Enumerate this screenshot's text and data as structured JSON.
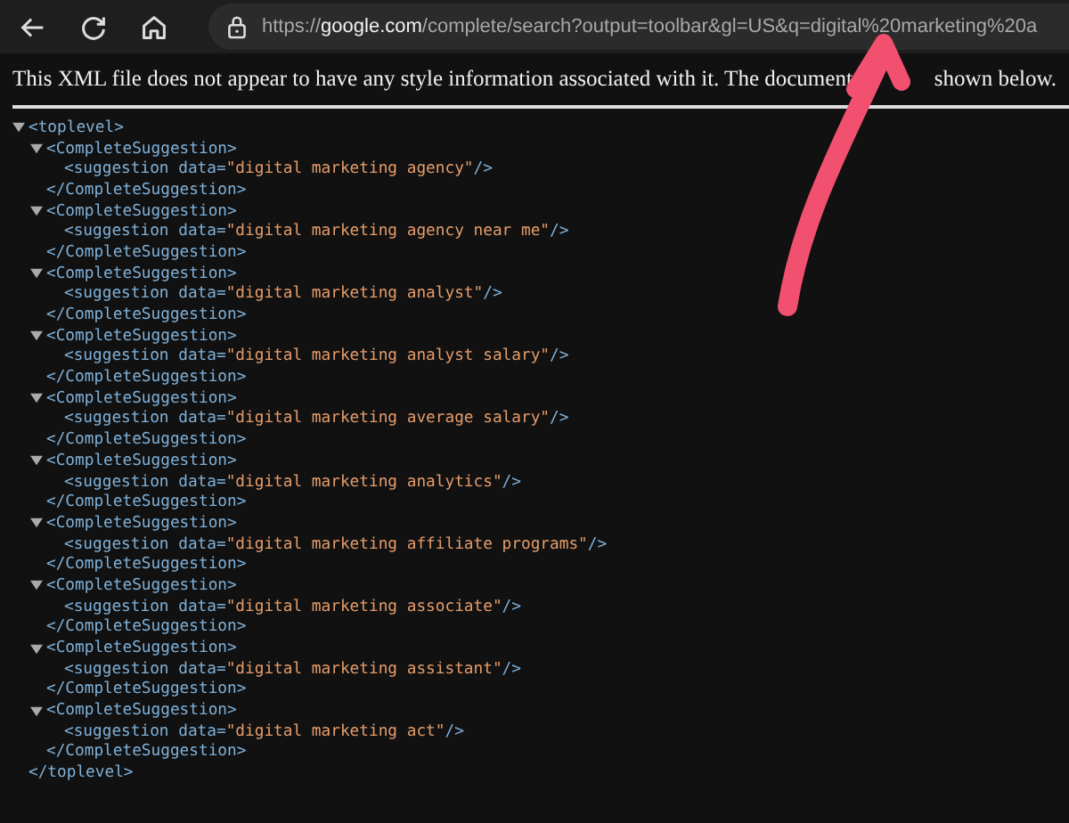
{
  "toolbar": {
    "url": {
      "scheme": "https://",
      "host": "google.com",
      "path": "/complete/search?output=toolbar&gl=US&q=digital%20marketing%20a"
    }
  },
  "notice": {
    "before_arrow": "This XML file does not appear to have any style information associated with it. The document",
    "after_arrow": "shown below."
  },
  "xml": {
    "open_tag": "<toplevel>",
    "close_tag": "</toplevel>",
    "expanded": true,
    "children": [
      {
        "open_tag": "<CompleteSuggestion>",
        "close_tag": "</CompleteSuggestion>",
        "expanded": true,
        "element": {
          "tag": "<suggestion data=",
          "value": "\"digital marketing agency\"",
          "end": "/>"
        }
      },
      {
        "open_tag": "<CompleteSuggestion>",
        "close_tag": "</CompleteSuggestion>",
        "expanded": true,
        "element": {
          "tag": "<suggestion data=",
          "value": "\"digital marketing agency near me\"",
          "end": "/>"
        }
      },
      {
        "open_tag": "<CompleteSuggestion>",
        "close_tag": "</CompleteSuggestion>",
        "expanded": true,
        "element": {
          "tag": "<suggestion data=",
          "value": "\"digital marketing analyst\"",
          "end": "/>"
        }
      },
      {
        "open_tag": "<CompleteSuggestion>",
        "close_tag": "</CompleteSuggestion>",
        "expanded": true,
        "element": {
          "tag": "<suggestion data=",
          "value": "\"digital marketing analyst salary\"",
          "end": "/>"
        }
      },
      {
        "open_tag": "<CompleteSuggestion>",
        "close_tag": "</CompleteSuggestion>",
        "expanded": true,
        "element": {
          "tag": "<suggestion data=",
          "value": "\"digital marketing average salary\"",
          "end": "/>"
        }
      },
      {
        "open_tag": "<CompleteSuggestion>",
        "close_tag": "</CompleteSuggestion>",
        "expanded": true,
        "element": {
          "tag": "<suggestion data=",
          "value": "\"digital marketing analytics\"",
          "end": "/>"
        }
      },
      {
        "open_tag": "<CompleteSuggestion>",
        "close_tag": "</CompleteSuggestion>",
        "expanded": true,
        "element": {
          "tag": "<suggestion data=",
          "value": "\"digital marketing affiliate programs\"",
          "end": "/>"
        }
      },
      {
        "open_tag": "<CompleteSuggestion>",
        "close_tag": "</CompleteSuggestion>",
        "expanded": true,
        "element": {
          "tag": "<suggestion data=",
          "value": "\"digital marketing associate\"",
          "end": "/>"
        }
      },
      {
        "open_tag": "<CompleteSuggestion>",
        "close_tag": "</CompleteSuggestion>",
        "expanded": true,
        "element": {
          "tag": "<suggestion data=",
          "value": "\"digital marketing assistant\"",
          "end": "/>"
        }
      },
      {
        "open_tag": "<CompleteSuggestion>",
        "close_tag": "</CompleteSuggestion>",
        "expanded": true,
        "element": {
          "tag": "<suggestion data=",
          "value": "\"digital marketing act\"",
          "end": "/>"
        }
      }
    ]
  }
}
